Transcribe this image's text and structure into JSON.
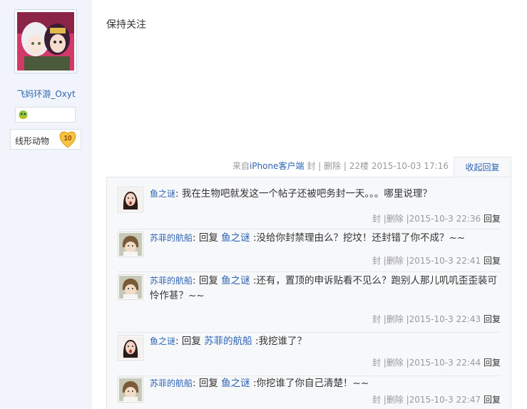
{
  "author": {
    "name": "飞妈环游_Oxyt",
    "level_name": "线形动物",
    "level_num": "10"
  },
  "post": {
    "text": "保持关注",
    "client_prefix": "来自",
    "client": "iPhone客户端",
    "lock": "封",
    "delete": "删除",
    "floor": "22楼",
    "time": "2015-10-03 17:16",
    "collapse": "收起回复"
  },
  "replies": [
    {
      "user": "鱼之谜",
      "reply_prefix": "",
      "reply_to": "",
      "content": "我在生物吧就发这一个帖子还被吧务封一天。。。哪里说理？",
      "lock": "封",
      "delete": "删除",
      "time": "2015-10-3 22:36",
      "reply": "回复",
      "avatar": "girl"
    },
    {
      "user": "苏菲的航船",
      "reply_prefix": "回复",
      "reply_to": "鱼之谜",
      "content": ":没给你封禁理由么？挖坟！还封错了你不成？~~",
      "lock": "封",
      "delete": "删除",
      "time": "2015-10-3 22:41",
      "reply": "回复",
      "avatar": "boy"
    },
    {
      "user": "苏菲的航船",
      "reply_prefix": "回复",
      "reply_to": "鱼之谜",
      "content": ":还有，置顶的申诉贴看不见么？跑别人那儿叽叽歪歪装可怜作甚？~~",
      "lock": "封",
      "delete": "删除",
      "time": "2015-10-3 22:43",
      "reply": "回复",
      "avatar": "boy"
    },
    {
      "user": "鱼之谜",
      "reply_prefix": "回复",
      "reply_to": "苏菲的航船",
      "content": ":我挖谁了？",
      "lock": "封",
      "delete": "删除",
      "time": "2015-10-3 22:44",
      "reply": "回复",
      "avatar": "girl"
    },
    {
      "user": "苏菲的航船",
      "reply_prefix": "回复",
      "reply_to": "鱼之谜",
      "content": ":你挖谁了你自己清楚！~~",
      "lock": "封",
      "delete": "删除",
      "time": "2015-10-3 22:47",
      "reply": "回复",
      "avatar": "boy"
    }
  ]
}
